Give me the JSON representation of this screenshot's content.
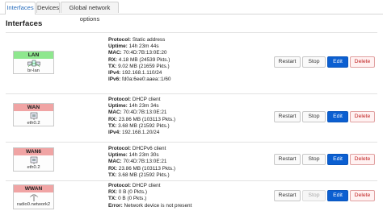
{
  "tabs": [
    {
      "label": "Interfaces",
      "active": true
    },
    {
      "label": "Devices",
      "active": false
    },
    {
      "label": "Global network options",
      "active": false
    }
  ],
  "section_title": "Interfaces",
  "buttons": {
    "restart": "Restart",
    "stop": "Stop",
    "edit": "Edit",
    "delete": "Delete"
  },
  "colors": {
    "lan_header": "#8ee78e",
    "wan_header": "#f0a4a4",
    "edit": "#0b5fd1",
    "delete_text": "#c02020"
  },
  "interfaces": [
    {
      "name": "LAN",
      "device": "br-lan",
      "icon": "bridge-icon",
      "details": [
        {
          "label": "Protocol:",
          "value": " Static address"
        },
        {
          "label": "Uptime:",
          "value": " 14h 23m 44s"
        },
        {
          "label": "MAC:",
          "value": " 70:4D:7B:13:0E:20"
        },
        {
          "label": "RX:",
          "value": " 4.18 MB (24539 Pkts.)"
        },
        {
          "label": "TX:",
          "value": " 9.02 MB (21659 Pkts.)"
        },
        {
          "label": "IPv4:",
          "value": " 192.168.1.110/24"
        },
        {
          "label": "IPv6:",
          "value": " fd0a:6ee0:aaea::1/60"
        }
      ],
      "stop_disabled": false
    },
    {
      "name": "WAN",
      "device": "eth0.2",
      "icon": "ethernet-icon",
      "details": [
        {
          "label": "Protocol:",
          "value": " DHCP client"
        },
        {
          "label": "Uptime:",
          "value": " 14h 23m 34s"
        },
        {
          "label": "MAC:",
          "value": " 70:4D:7B:13:0E:21"
        },
        {
          "label": "RX:",
          "value": " 23.86 MB (103113 Pkts.)"
        },
        {
          "label": "TX:",
          "value": " 3.68 MB (21592 Pkts.)"
        },
        {
          "label": "IPv4:",
          "value": " 192.168.1.20/24"
        }
      ],
      "stop_disabled": false
    },
    {
      "name": "WAN6",
      "device": "eth0.2",
      "icon": "ethernet-icon",
      "details": [
        {
          "label": "Protocol:",
          "value": " DHCPv6 client"
        },
        {
          "label": "Uptime:",
          "value": " 14h 23m 30s"
        },
        {
          "label": "MAC:",
          "value": " 70:4D:7B:13:0E:21"
        },
        {
          "label": "RX:",
          "value": " 23.86 MB (103113 Pkts.)"
        },
        {
          "label": "TX:",
          "value": " 3.68 MB (21592 Pkts.)"
        }
      ],
      "stop_disabled": false
    },
    {
      "name": "WWAN",
      "device": "radio0.network2",
      "icon": "wireless-icon",
      "details": [
        {
          "label": "Protocol:",
          "value": " DHCP client"
        },
        {
          "label": "RX:",
          "value": " 0 B (0 Pkts.)"
        },
        {
          "label": "TX:",
          "value": " 0 B (0 Pkts.)"
        },
        {
          "label": "Error:",
          "value": " Network device is not present"
        }
      ],
      "stop_disabled": true
    }
  ]
}
